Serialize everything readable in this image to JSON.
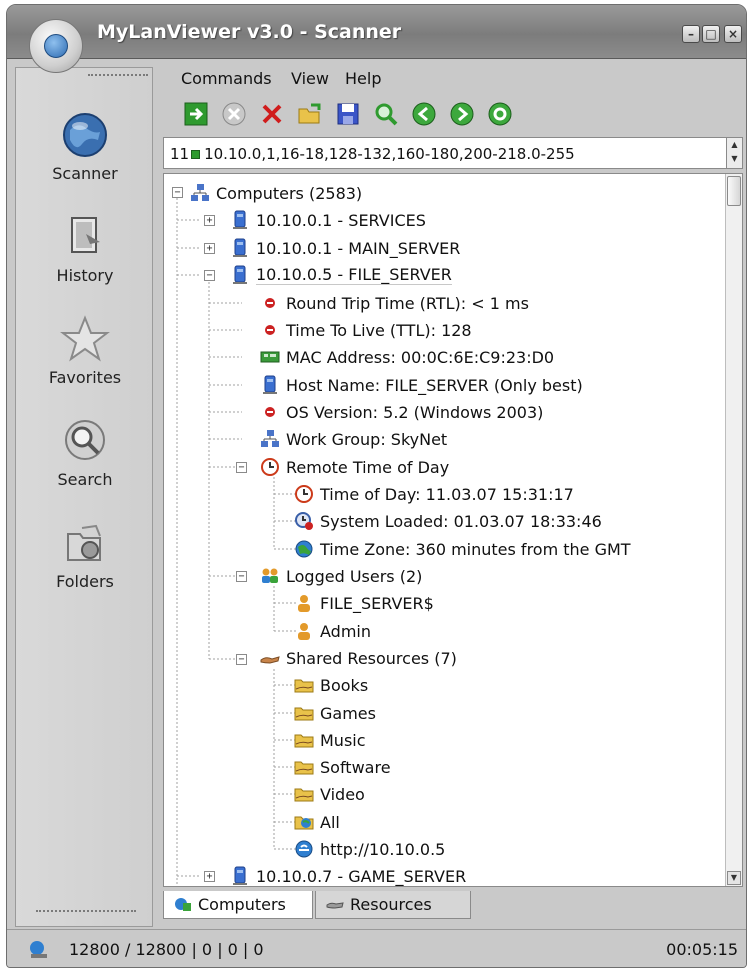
{
  "window": {
    "title": "MyLanViewer v3.0 - Scanner"
  },
  "sidebar": {
    "items": [
      {
        "label": "Scanner",
        "icon": "globe-scanner-icon"
      },
      {
        "label": "History",
        "icon": "history-book-icon"
      },
      {
        "label": "Favorites",
        "icon": "star-icon"
      },
      {
        "label": "Search",
        "icon": "magnifier-icon"
      },
      {
        "label": "Folders",
        "icon": "folders-icon"
      }
    ]
  },
  "menu": {
    "items": [
      "Commands",
      "View",
      "Help"
    ]
  },
  "toolbar": {
    "buttons": [
      "enter-icon",
      "stop-icon",
      "delete-icon",
      "open-icon",
      "save-icon",
      "find-icon",
      "back-icon",
      "forward-icon",
      "refresh-icon"
    ]
  },
  "address": {
    "prefix": "11",
    "ranges": "10.10.0,1,16-18,128-132,160-180,200-218.0-255"
  },
  "tree": {
    "root": "Computers (2583)",
    "hosts": [
      "10.10.0.1 - SERVICES",
      "10.10.0.1 - MAIN_SERVER",
      "10.10.0.5 - FILE_SERVER",
      "10.10.0.7 - GAME_SERVER"
    ],
    "details": [
      "Round Trip Time (RTL): < 1 ms",
      "Time To Live (TTL): 128",
      "MAC Address: 00:0C:6E:C9:23:D0",
      "Host Name: FILE_SERVER (Only best)",
      "OS Version: 5.2 (Windows 2003)",
      "Work Group: SkyNet",
      "Remote Time of Day"
    ],
    "time": [
      "Time of Day: 11.03.07 15:31:17",
      "System Loaded: 01.03.07 18:33:46",
      "Time Zone: 360 minutes from the GMT"
    ],
    "users_label": "Logged Users (2)",
    "users": [
      "FILE_SERVER$",
      "Admin"
    ],
    "shares_label": "Shared Resources (7)",
    "shares": [
      "Books",
      "Games",
      "Music",
      "Software",
      "Video",
      "All",
      "http://10.10.0.5"
    ]
  },
  "tabs": {
    "computers": "Computers",
    "resources": "Resources"
  },
  "status": {
    "counts": "12800 / 12800 | 0 | 0 | 0",
    "time": "00:05:15"
  },
  "colors": {
    "accent_green": "#2c9a2c",
    "accent_red": "#cc2222",
    "folder_yellow": "#e9c24a"
  }
}
